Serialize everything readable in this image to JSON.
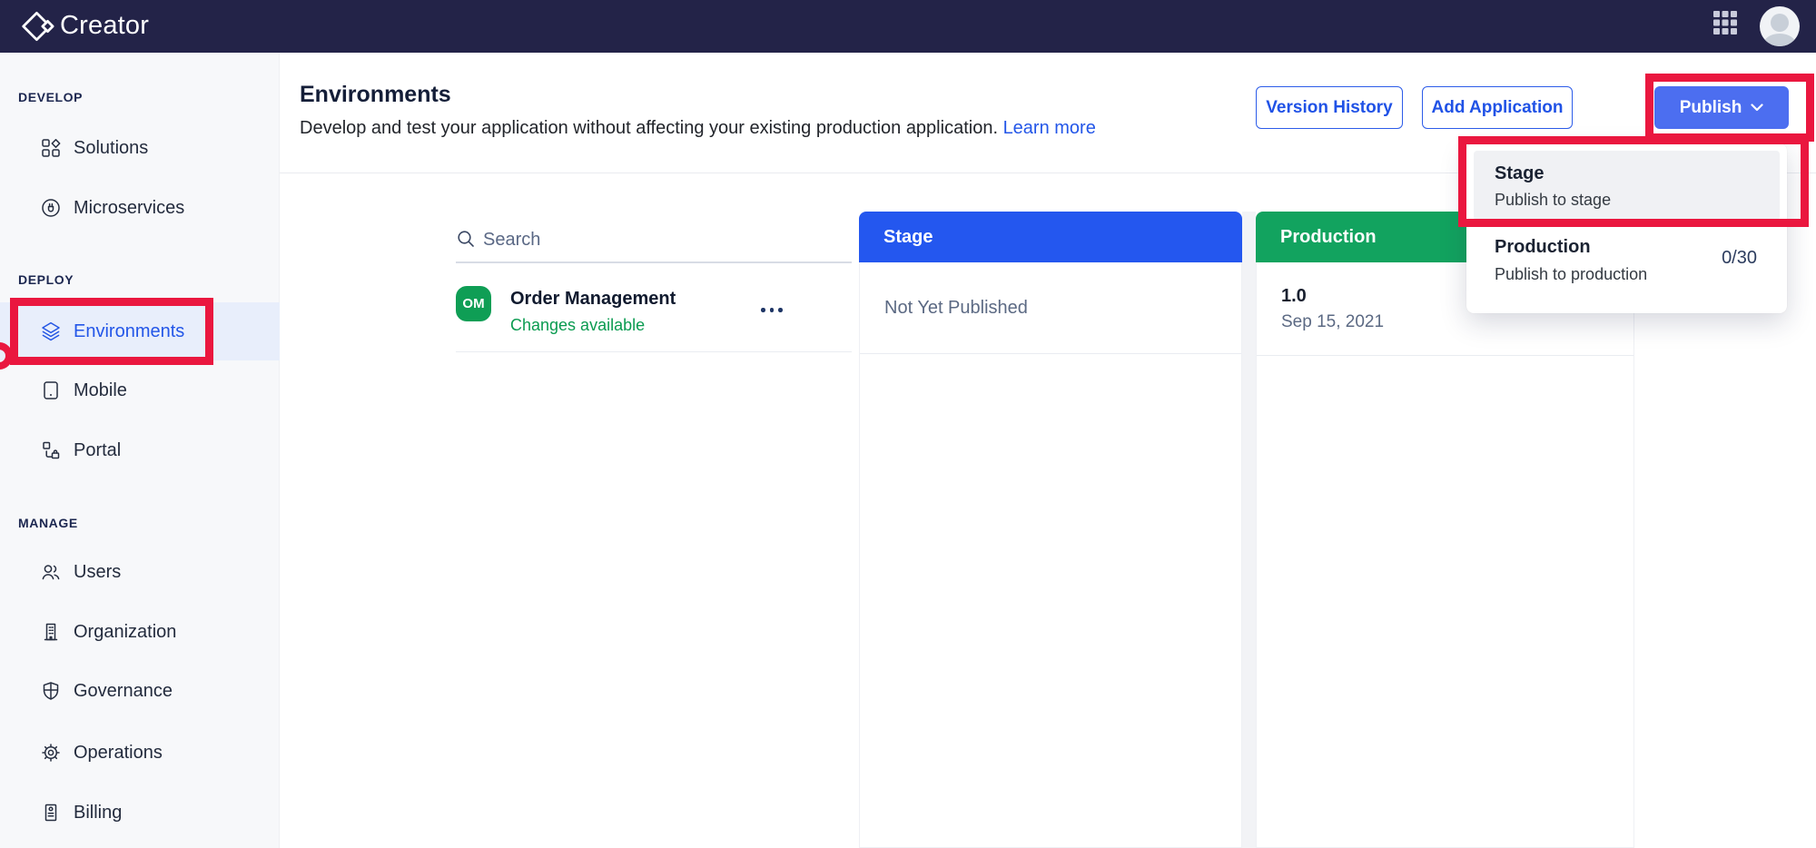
{
  "navbar": {
    "brand": "Creator"
  },
  "sidebar": {
    "sections": [
      {
        "label": "DEVELOP",
        "items": [
          {
            "label": "Solutions",
            "icon": "solutions-icon"
          },
          {
            "label": "Microservices",
            "icon": "microservices-icon"
          }
        ]
      },
      {
        "label": "DEPLOY",
        "items": [
          {
            "label": "Environments",
            "icon": "environments-icon",
            "active": true
          },
          {
            "label": "Mobile",
            "icon": "mobile-icon"
          },
          {
            "label": "Portal",
            "icon": "portal-icon"
          }
        ]
      },
      {
        "label": "MANAGE",
        "items": [
          {
            "label": "Users",
            "icon": "users-icon"
          },
          {
            "label": "Organization",
            "icon": "organization-icon"
          },
          {
            "label": "Governance",
            "icon": "governance-icon"
          },
          {
            "label": "Operations",
            "icon": "operations-icon"
          },
          {
            "label": "Billing",
            "icon": "billing-icon"
          }
        ]
      }
    ]
  },
  "header": {
    "title": "Environments",
    "description": "Develop and test your application without affecting your existing production application.",
    "learn_more_label": "Learn more",
    "version_history_label": "Version History",
    "add_application_label": "Add Application",
    "publish_label": "Publish"
  },
  "publish_menu": {
    "items": [
      {
        "title": "Stage",
        "subtitle": "Publish to stage",
        "highlighted": true
      },
      {
        "title": "Production",
        "subtitle": "Publish to production",
        "badge": "0/30"
      }
    ]
  },
  "app_list": {
    "search_placeholder": "Search",
    "apps": [
      {
        "initials": "OM",
        "name": "Order Management",
        "status": "Changes available"
      }
    ]
  },
  "columns": [
    {
      "title": "Stage",
      "header_color": "#2457EF",
      "entries": [
        {
          "text": "Not Yet Published"
        }
      ]
    },
    {
      "title": "Production",
      "header_color": "#12A35F",
      "entries": [
        {
          "version": "1.0",
          "date": "Sep 15, 2021"
        }
      ]
    }
  ],
  "colors": {
    "navbar_bg": "#232348",
    "accent_blue": "#2356E8",
    "publish_button_blue": "#4C6EF0",
    "stage_header_blue": "#2457EF",
    "production_green": "#12A35F",
    "status_green": "#0A9B50",
    "annotation_red": "#EA173F",
    "active_item_bg": "#E8EEFB"
  }
}
